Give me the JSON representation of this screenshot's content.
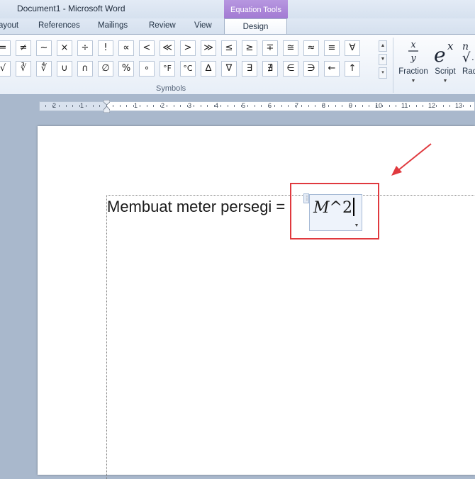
{
  "window": {
    "title": "Document1  -  Microsoft Word",
    "context_tab_group": "Equation Tools"
  },
  "tabs": [
    {
      "label": "ayout"
    },
    {
      "label": "References"
    },
    {
      "label": "Mailings"
    },
    {
      "label": "Review"
    },
    {
      "label": "View"
    },
    {
      "label": "Design"
    }
  ],
  "ribbon": {
    "symbols_row1": [
      "=",
      "≠",
      "~",
      "×",
      "÷",
      "!",
      "∝",
      "<",
      "≪",
      ">",
      "≫",
      "≤",
      "≥",
      "∓",
      "≅",
      "≈",
      "≡",
      "∀"
    ],
    "symbols_row2": [
      "√",
      "∛",
      "∜",
      "∪",
      "∩",
      "∅",
      "%",
      "∘",
      "°F",
      "°C",
      "∆",
      "∇",
      "∃",
      "∄",
      "∈",
      "∋",
      "←",
      "↑"
    ],
    "symbols_group_label": "Symbols",
    "buttons": [
      {
        "label": "Fraction",
        "icon": "fraction-icon"
      },
      {
        "label": "Script",
        "icon": "script-icon"
      },
      {
        "label": "Rad",
        "icon": "radical-icon"
      }
    ]
  },
  "ruler": {
    "numbers": [
      "2",
      "1",
      "1",
      "2",
      "3",
      "4",
      "5",
      "6",
      "7",
      "8",
      "9",
      "10",
      "11",
      "12",
      "13"
    ]
  },
  "document": {
    "text_before_equation": "Membuat meter persegi = ",
    "equation": {
      "variable": "M",
      "rest": "^2"
    }
  },
  "annotations": {
    "highlight_color": "#e0393e"
  }
}
